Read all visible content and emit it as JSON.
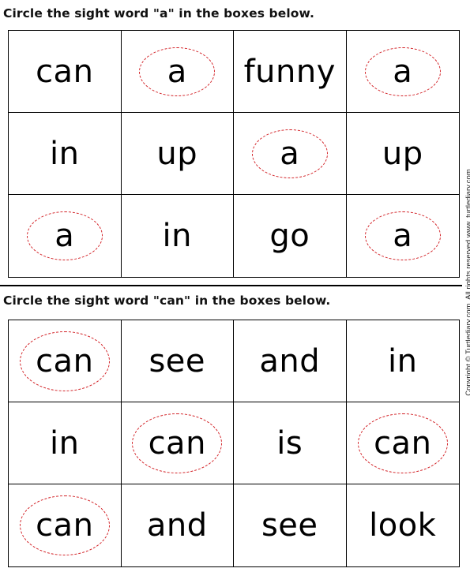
{
  "worksheet": {
    "sections": [
      {
        "instruction": "Circle the sight word \"a\" in the boxes below.",
        "target_word": "a",
        "rows": [
          [
            {
              "word": "can",
              "circled": false
            },
            {
              "word": "a",
              "circled": true
            },
            {
              "word": "funny",
              "circled": false
            },
            {
              "word": "a",
              "circled": true
            }
          ],
          [
            {
              "word": "in",
              "circled": false
            },
            {
              "word": "up",
              "circled": false
            },
            {
              "word": "a",
              "circled": true
            },
            {
              "word": "up",
              "circled": false
            }
          ],
          [
            {
              "word": "a",
              "circled": true
            },
            {
              "word": "in",
              "circled": false
            },
            {
              "word": "go",
              "circled": false
            },
            {
              "word": "a",
              "circled": true
            }
          ]
        ]
      },
      {
        "instruction": "Circle the sight word \"can\" in the boxes below.",
        "target_word": "can",
        "rows": [
          [
            {
              "word": "can",
              "circled": true
            },
            {
              "word": "see",
              "circled": false
            },
            {
              "word": "and",
              "circled": false
            },
            {
              "word": "in",
              "circled": false
            }
          ],
          [
            {
              "word": "in",
              "circled": false
            },
            {
              "word": "can",
              "circled": true
            },
            {
              "word": "is",
              "circled": false
            },
            {
              "word": "can",
              "circled": true
            }
          ],
          [
            {
              "word": "can",
              "circled": true
            },
            {
              "word": "and",
              "circled": false
            },
            {
              "word": "see",
              "circled": false
            },
            {
              "word": "look",
              "circled": false
            }
          ]
        ]
      }
    ],
    "circle_color": "#d21f24",
    "copyright": "Copyright © Turtlediary.com. All rights reserved   www. turtlediary.com"
  }
}
